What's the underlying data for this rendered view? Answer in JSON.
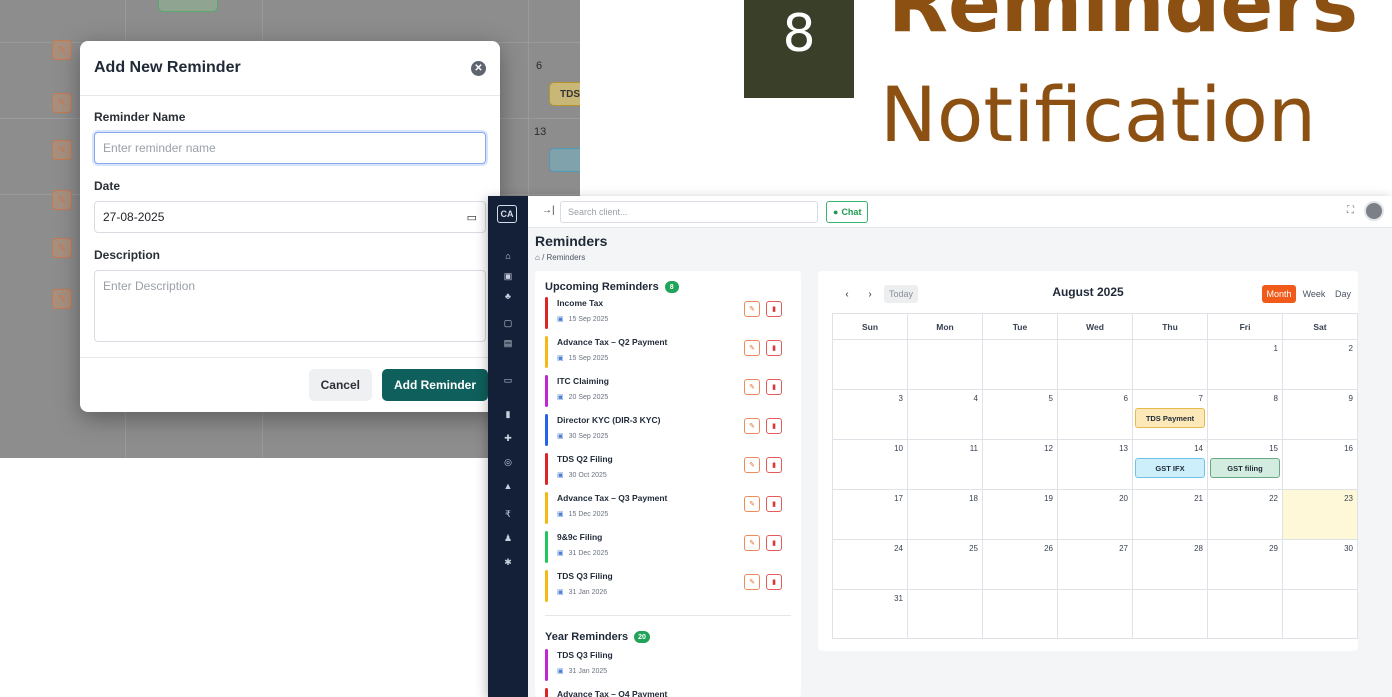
{
  "heading": {
    "number": "8",
    "title": "Reminders",
    "subtitle": "Notification"
  },
  "modal": {
    "title": "Add New Reminder",
    "name_label": "Reminder Name",
    "name_placeholder": "Enter reminder name",
    "date_label": "Date",
    "date_value": "27-08-2025",
    "description_label": "Description",
    "description_placeholder": "Enter Description",
    "cancel_label": "Cancel",
    "add_label": "Add Reminder"
  },
  "background_calendar": {
    "visible_dates": [
      "6",
      "13"
    ],
    "visible_events": [
      "TDS"
    ]
  },
  "app": {
    "logo": "CA",
    "search_placeholder": "Search client...",
    "chat_label": "Chat",
    "page_title": "Reminders",
    "breadcrumb": "Reminders",
    "upcoming": {
      "title": "Upcoming Reminders",
      "count": "8",
      "items": [
        {
          "name": "Income Tax",
          "date": "15 Sep 2025",
          "color": "#dc2626"
        },
        {
          "name": "Advance Tax – Q2 Payment",
          "date": "15 Sep 2025",
          "color": "#f5b915"
        },
        {
          "name": "ITC Claiming",
          "date": "20 Sep 2025",
          "color": "#c026d3"
        },
        {
          "name": "Director KYC (DIR-3 KYC)",
          "date": "30 Sep 2025",
          "color": "#2563eb"
        },
        {
          "name": "TDS Q2 Filing",
          "date": "30 Oct 2025",
          "color": "#dc2626"
        },
        {
          "name": "Advance Tax – Q3 Payment",
          "date": "15 Dec 2025",
          "color": "#f5b915"
        },
        {
          "name": "9&9c Filing",
          "date": "31 Dec 2025",
          "color": "#22c55e"
        },
        {
          "name": "TDS Q3 Filing",
          "date": "31 Jan 2026",
          "color": "#f5b915"
        }
      ]
    },
    "year": {
      "title": "Year Reminders",
      "count": "20",
      "items": [
        {
          "name": "TDS Q3 Filing",
          "date": "31 Jan 2025",
          "color": "#c026d3"
        },
        {
          "name": "Advance Tax – Q4 Payment",
          "date": "",
          "color": "#dc2626"
        }
      ]
    },
    "calendar": {
      "today_label": "Today",
      "month_title": "August 2025",
      "views": [
        "Month",
        "Week",
        "Day"
      ],
      "weekdays": [
        "Sun",
        "Mon",
        "Tue",
        "Wed",
        "Thu",
        "Fri",
        "Sat"
      ],
      "weeks": [
        [
          "",
          "",
          "",
          "",
          "",
          "1",
          "2"
        ],
        [
          "3",
          "4",
          "5",
          "6",
          "7",
          "8",
          "9"
        ],
        [
          "10",
          "11",
          "12",
          "13",
          "14",
          "15",
          "16"
        ],
        [
          "17",
          "18",
          "19",
          "20",
          "21",
          "22",
          "23"
        ],
        [
          "24",
          "25",
          "26",
          "27",
          "28",
          "29",
          "30"
        ],
        [
          "31",
          "",
          "",
          "",
          "",
          "",
          ""
        ]
      ],
      "events": [
        {
          "label": "TDS Payment",
          "week": 1,
          "day": 4,
          "bg": "#fde9b8",
          "border": "#e7b94a"
        },
        {
          "label": "GST IFX",
          "week": 2,
          "day": 4,
          "bg": "#cdeefb",
          "border": "#6cc3e6"
        },
        {
          "label": "GST filing",
          "week": 2,
          "day": 5,
          "bg": "#d3ece0",
          "border": "#6aa883"
        }
      ],
      "today_cell": {
        "week": 3,
        "day": 6
      }
    }
  }
}
